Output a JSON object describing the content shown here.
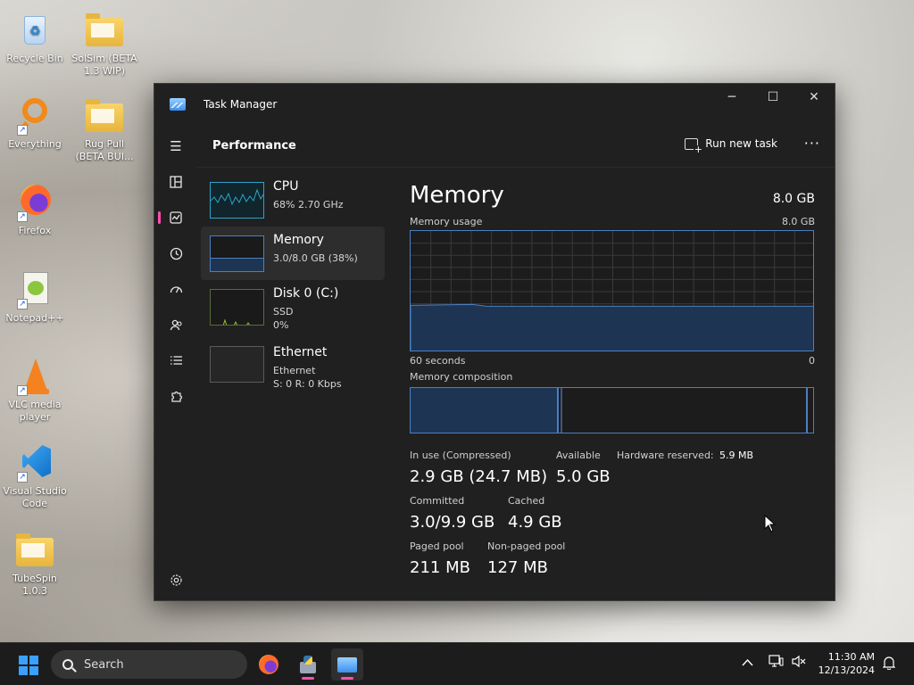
{
  "desktop": {
    "icons": [
      {
        "label": "Recycle Bin"
      },
      {
        "label": "SolSim (BETA 1.3 WIP)"
      },
      {
        "label": "Everything"
      },
      {
        "label": "Rug Pull (BETA BUI..."
      },
      {
        "label": "Firefox"
      },
      {
        "label": "Notepad++"
      },
      {
        "label": "VLC media player"
      },
      {
        "label": "Visual Studio Code"
      },
      {
        "label": "TubeSpin 1.0.3"
      }
    ]
  },
  "window": {
    "title": "Task Manager",
    "minimize_glyph": "─",
    "maximize_glyph": "☐",
    "close_glyph": "✕"
  },
  "header": {
    "page_title": "Performance",
    "run_new_task": "Run new task",
    "more": "···"
  },
  "devices": [
    {
      "name": "CPU",
      "line2": "68%  2.70 GHz",
      "line3": ""
    },
    {
      "name": "Memory",
      "line2": "3.0/8.0 GB (38%)",
      "line3": ""
    },
    {
      "name": "Disk 0 (C:)",
      "line2": "SSD",
      "line3": "0%"
    },
    {
      "name": "Ethernet",
      "line2": "Ethernet",
      "line3": "S: 0  R: 0 Kbps"
    }
  ],
  "memory": {
    "title": "Memory",
    "total": "8.0 GB",
    "usage_label": "Memory usage",
    "usage_max": "8.0 GB",
    "axis_left": "60 seconds",
    "axis_right": "0",
    "composition_label": "Memory composition",
    "usage_fraction": 0.38,
    "stats": {
      "in_use_label": "In use (Compressed)",
      "in_use_value": "2.9 GB (24.7 MB)",
      "available_label": "Available",
      "available_value": "5.0 GB",
      "hw_reserved_label": "Hardware reserved:",
      "hw_reserved_value": "5.9 MB",
      "committed_label": "Committed",
      "committed_value": "3.0/9.9 GB",
      "cached_label": "Cached",
      "cached_value": "4.9 GB",
      "paged_label": "Paged pool",
      "paged_value": "211 MB",
      "nonpaged_label": "Non-paged pool",
      "nonpaged_value": "127 MB"
    }
  },
  "taskbar": {
    "search_label": "Search",
    "time": "11:30 AM",
    "date": "12/13/2024",
    "accent": "#ff4fae"
  },
  "colors": {
    "graph_line": "#4c7fc0",
    "graph_fill": "#1d3553",
    "cpu_line": "#2fa3c9",
    "disk_line": "#8fbf3a"
  }
}
